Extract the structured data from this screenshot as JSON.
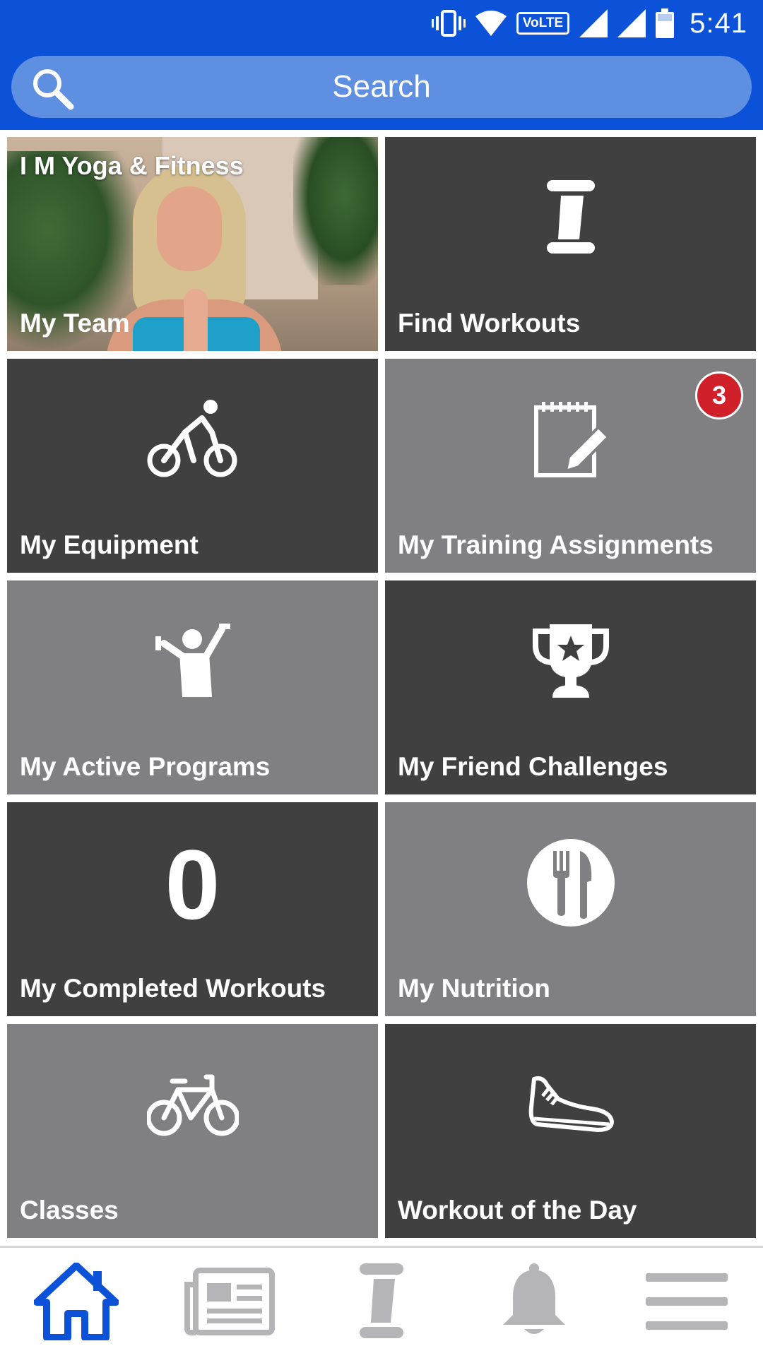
{
  "status_bar": {
    "time": "5:41",
    "network_badge": "VoLTE",
    "icons": [
      "vibrate-icon",
      "wifi-icon",
      "volte-icon",
      "signal-icon",
      "signal-icon",
      "battery-icon"
    ]
  },
  "search": {
    "placeholder": "Search",
    "icon": "search-icon"
  },
  "tiles": [
    {
      "title": "I M Yoga & Fitness",
      "label": "My Team",
      "style": "photo"
    },
    {
      "label": "Find Workouts",
      "icon": "roller-icon",
      "style": "dark"
    },
    {
      "label": "My Equipment",
      "icon": "cyclist-icon",
      "style": "dark"
    },
    {
      "label": "My Training Assignments",
      "icon": "notepad-icon",
      "style": "light",
      "badge": "3"
    },
    {
      "label": "My Active Programs",
      "icon": "weightlifter-icon",
      "style": "light"
    },
    {
      "label": "My Friend Challenges",
      "icon": "trophy-icon",
      "style": "dark"
    },
    {
      "label": "My Completed Workouts",
      "value": "0",
      "style": "dark"
    },
    {
      "label": "My Nutrition",
      "icon": "utensils-icon",
      "style": "light"
    },
    {
      "label": "Classes",
      "icon": "bicycle-icon",
      "style": "light"
    },
    {
      "label": "Workout of the Day",
      "icon": "sneaker-icon",
      "style": "dark"
    }
  ],
  "bottom_nav": {
    "items": [
      {
        "icon": "home-icon",
        "active": true
      },
      {
        "icon": "newspaper-icon",
        "active": false
      },
      {
        "icon": "roller-icon",
        "active": false
      },
      {
        "icon": "bell-icon",
        "active": false
      },
      {
        "icon": "menu-icon",
        "active": false
      }
    ],
    "active_color": "#0c52d8",
    "inactive_color": "#b5b5b8"
  },
  "colors": {
    "header": "#0c52d8",
    "search_bar": "#5f8fe0",
    "tile_dark": "#404040",
    "tile_light": "#808083",
    "badge": "#d0202a"
  }
}
